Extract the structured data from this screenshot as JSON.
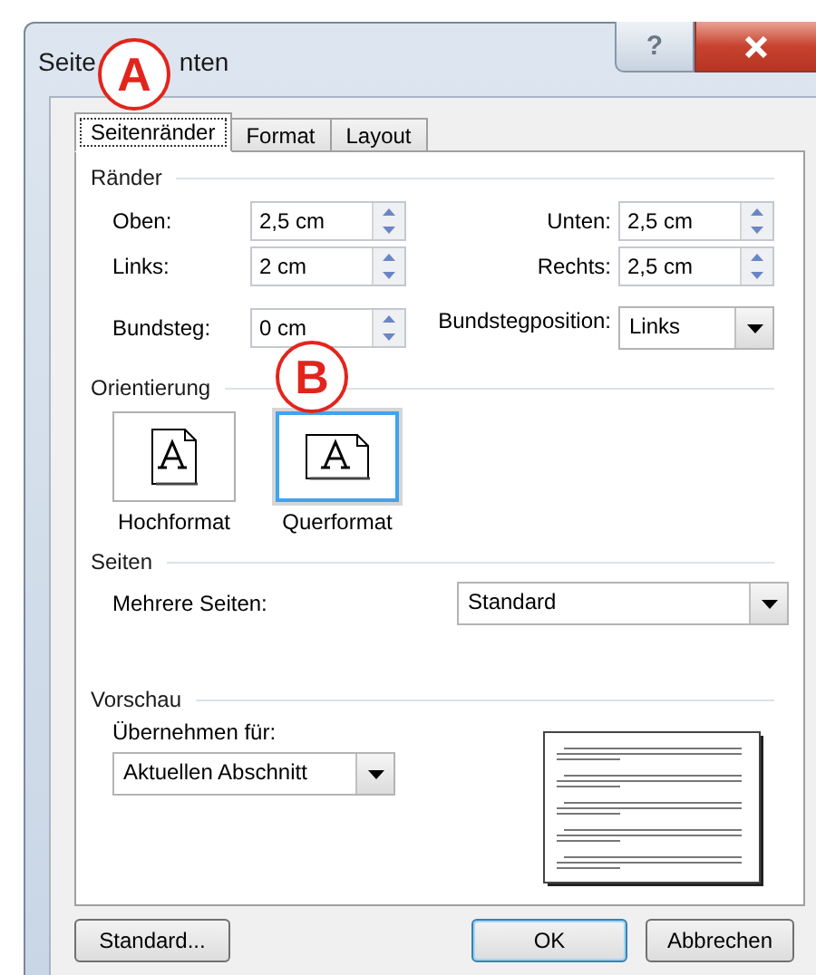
{
  "window": {
    "title_parts": [
      "Seite",
      "nten"
    ],
    "help": "?"
  },
  "annotations": [
    {
      "label": "A"
    },
    {
      "label": "B"
    }
  ],
  "tabs": [
    {
      "label": "Seitenränder",
      "selected": true
    },
    {
      "label": "Format",
      "selected": false
    },
    {
      "label": "Layout",
      "selected": false
    }
  ],
  "margins": {
    "heading": "Ränder",
    "fields": [
      {
        "label": "Oben:",
        "value": "2,5 cm",
        "kind": "spin"
      },
      {
        "label": "Unten:",
        "value": "2,5 cm",
        "kind": "spin"
      },
      {
        "label": "Links:",
        "value": "2 cm",
        "kind": "spin"
      },
      {
        "label": "Rechts:",
        "value": "2,5 cm",
        "kind": "spin"
      },
      {
        "label": "Bundsteg:",
        "value": "0 cm",
        "kind": "spin"
      },
      {
        "label": "Bundstegposition:",
        "value": "Links",
        "kind": "combo"
      }
    ]
  },
  "orientation": {
    "heading": "Orientierung",
    "options": [
      {
        "label": "Hochformat",
        "selected": false,
        "kind": "portrait"
      },
      {
        "label": "Querformat",
        "selected": true,
        "kind": "landscape"
      }
    ]
  },
  "pages": {
    "heading": "Seiten",
    "label": "Mehrere Seiten:",
    "value": "Standard"
  },
  "preview": {
    "heading": "Vorschau",
    "label": "Übernehmen für:",
    "value": "Aktuellen Abschnitt"
  },
  "buttons": [
    {
      "label": "Standard...",
      "kind": "left"
    },
    {
      "label": "OK",
      "kind": "default"
    },
    {
      "label": "Abbrechen",
      "kind": "normal"
    }
  ]
}
